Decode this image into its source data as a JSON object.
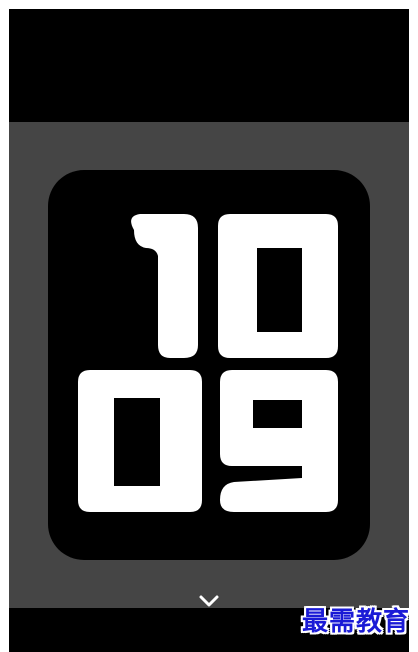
{
  "watch": {
    "hours": "10",
    "minutes": "09",
    "digit_color": "#ffffff",
    "face_color": "#000000",
    "background_color": "#454545"
  },
  "controls": {
    "expand_icon": "chevron-down-icon"
  },
  "watermark": {
    "text": "最需教育"
  }
}
